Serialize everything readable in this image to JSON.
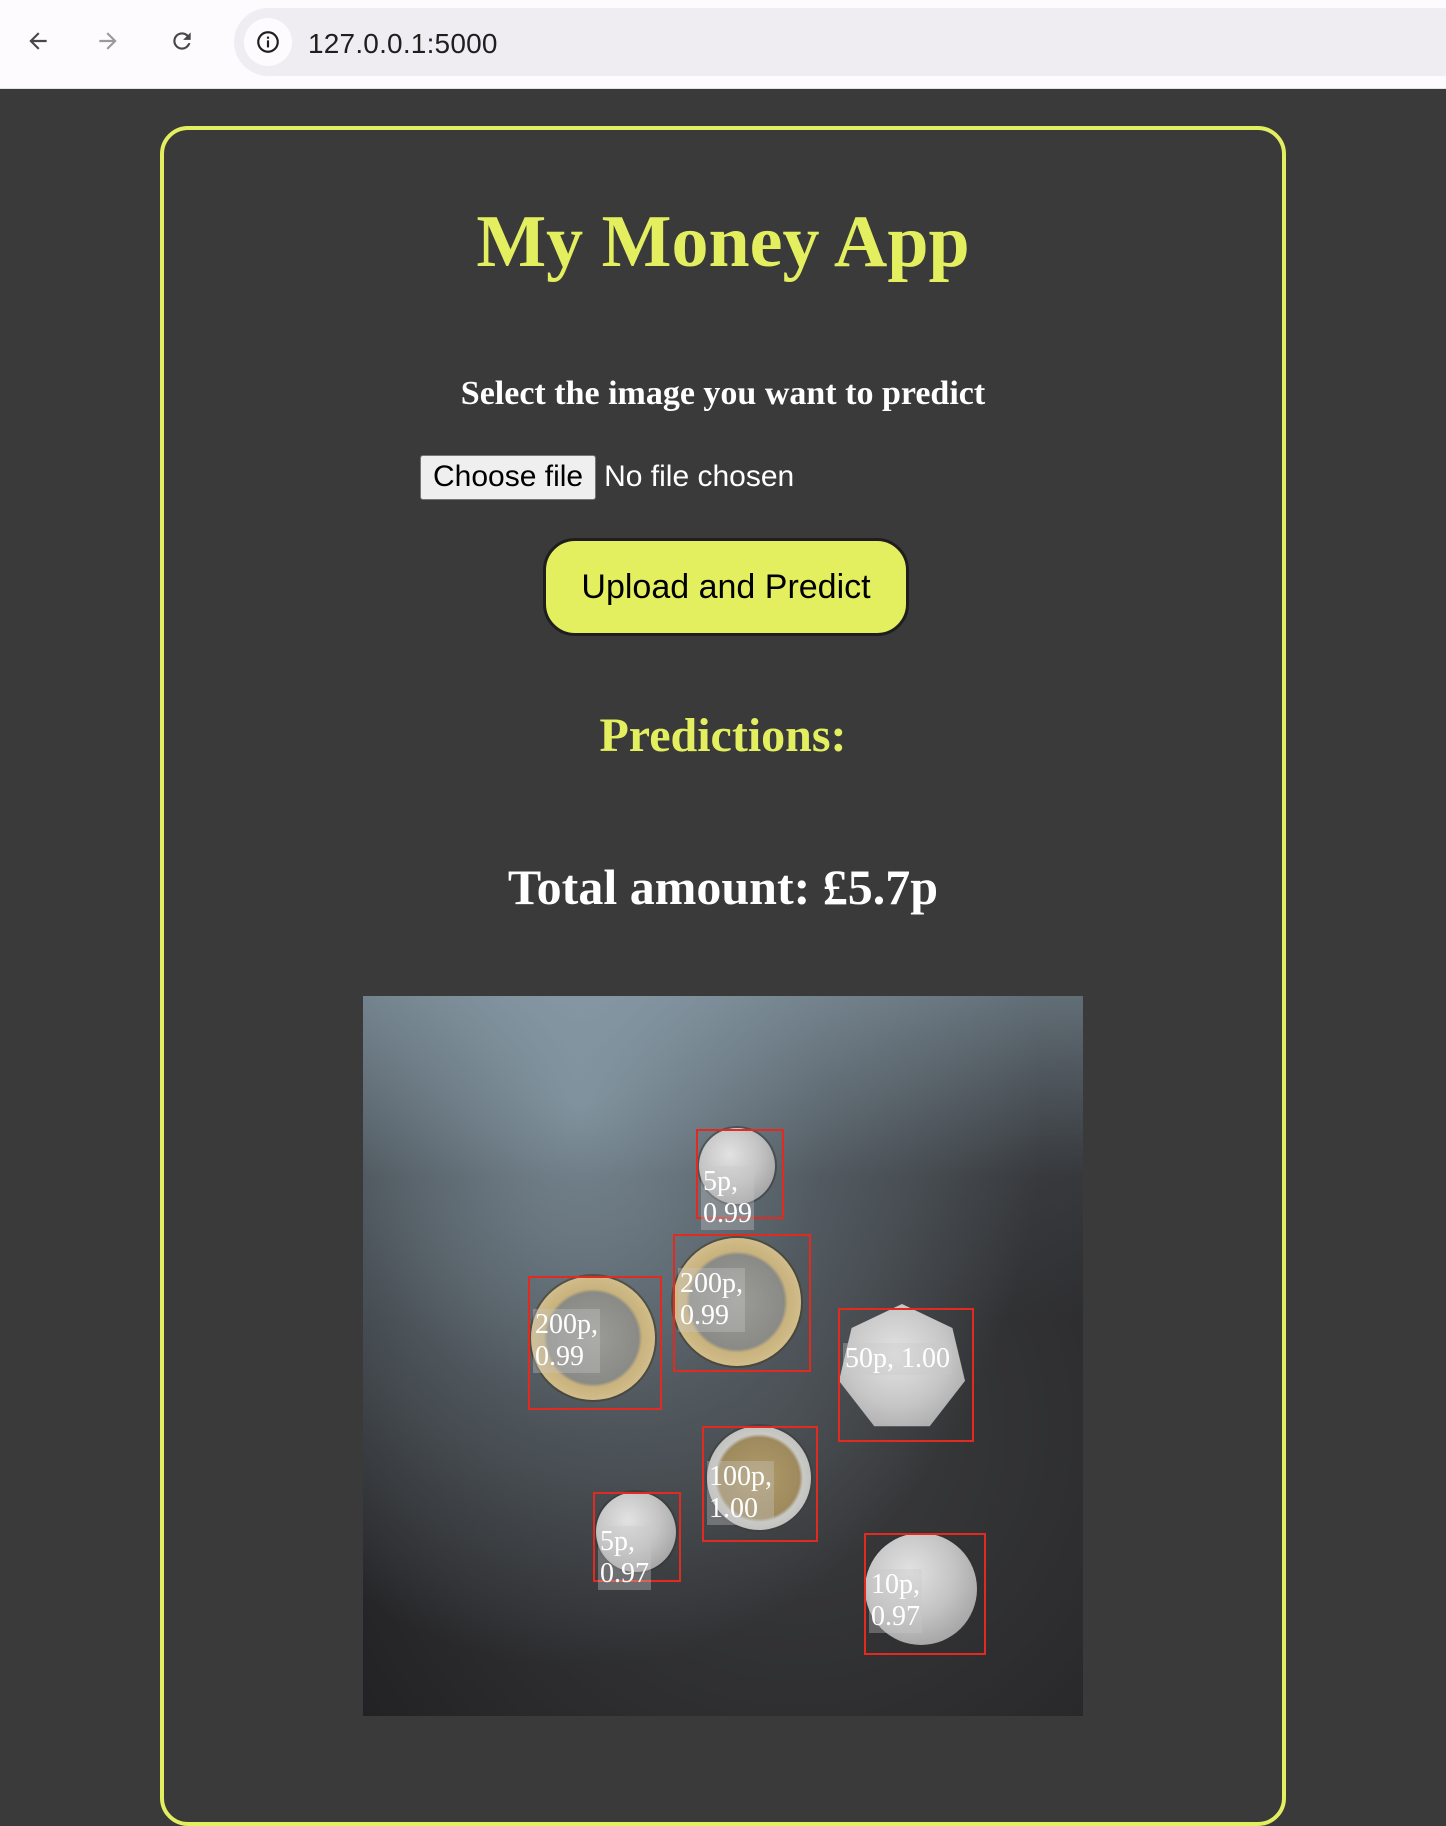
{
  "browser": {
    "url": "127.0.0.1:5000",
    "back_icon": "arrow-left-icon",
    "forward_icon": "arrow-right-icon",
    "reload_icon": "reload-icon",
    "site_info_icon": "info-icon"
  },
  "app": {
    "title": "My Money App",
    "select_label": "Select the image you want to predict",
    "choose_file_label": "Choose file",
    "no_file_text": "No file chosen",
    "upload_button_label": "Upload and Predict",
    "predictions_heading": "Predictions:",
    "total_amount_label": "Total amount:",
    "total_amount_value": "£5.7p",
    "accent_color": "#e4ef5f",
    "background_color": "#3a3a3a"
  },
  "detections": [
    {
      "label": "5p,\n0.99"
    },
    {
      "label": "200p,\n0.99"
    },
    {
      "label": "200p,\n0.99"
    },
    {
      "label": "50p, 1.00"
    },
    {
      "label": "100p,\n1.00"
    },
    {
      "label": "5p,\n0.97"
    },
    {
      "label": "10p,\n0.97"
    }
  ]
}
